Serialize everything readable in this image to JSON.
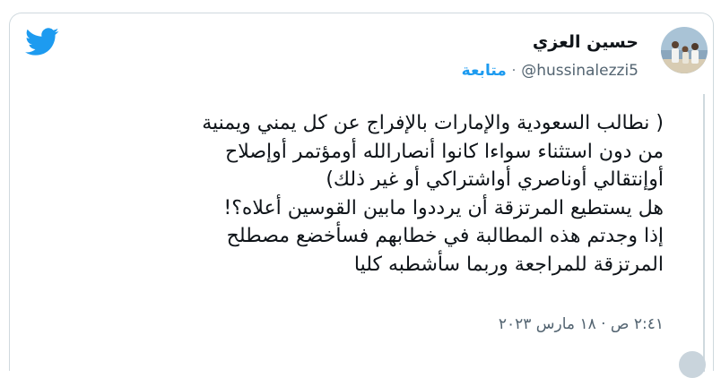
{
  "tweet": {
    "author_name": "حسين العزي",
    "handle": "@hussinalezzi5",
    "separator": "·",
    "follow_label": "متابعة",
    "text": "( نطالب السعودية والإمارات بالإفراج عن كل يمني ويمنية\nمن دون استثناء سواءا كانوا  أنصارالله أومؤتمر أوإصلاح\nأوإنتقالي أوناصري أواشتراكي أو غير ذلك)\nهل يستطيع المرتزقة أن يرددوا مابين القوسين أعلاه؟!\nإذا وجدتم هذه المطالبة في خطابهم فسأخضع مصطلح\nالمرتزقة للمراجعة وربما سأشطبه كليا",
    "timestamp": "٢:٤١ ص · ١٨ مارس ٢٠٢٣"
  },
  "icons": {
    "brand": "twitter-bird-icon",
    "brand_color": "#1d9bf0"
  }
}
